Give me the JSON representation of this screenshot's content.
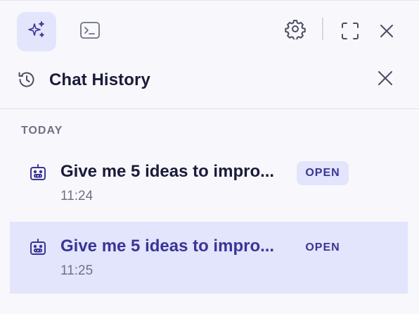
{
  "toolbar": {
    "modes": [
      {
        "icon": "sparkles-icon",
        "active": true
      },
      {
        "icon": "terminal-icon",
        "active": false
      }
    ],
    "icons": [
      "gear-icon",
      "fullscreen-icon",
      "close-icon"
    ]
  },
  "header": {
    "title": "Chat History",
    "icon": "history-icon",
    "close_icon": "close-icon"
  },
  "history": {
    "section_label": "TODAY",
    "items": [
      {
        "title": "Give me 5 ideas to impro...",
        "time": "11:24",
        "badge": "OPEN",
        "active": false
      },
      {
        "title": "Give me 5 ideas to impro...",
        "time": "11:25",
        "badge": "OPEN",
        "active": true
      }
    ]
  },
  "colors": {
    "accent": "#3B3496",
    "accent_bg": "#E2E5FB",
    "text": "#1B1B3A",
    "muted": "#6E7186",
    "background": "#F8F8FC"
  }
}
